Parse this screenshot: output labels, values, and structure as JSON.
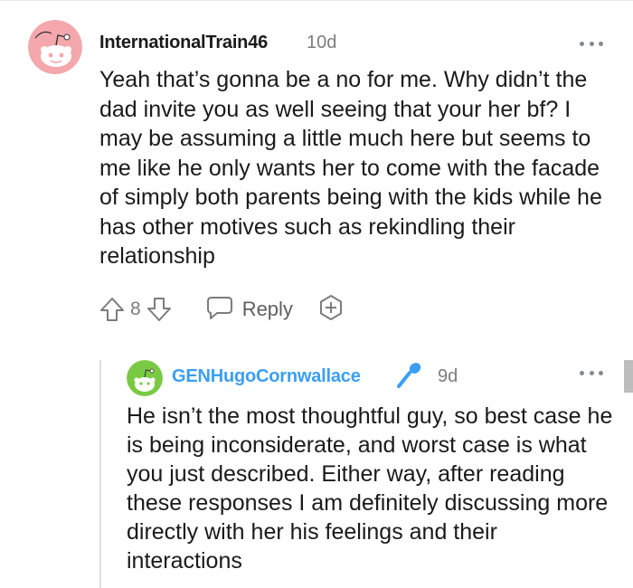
{
  "comment": {
    "username": "InternationalTrain46",
    "age": "10d",
    "avatar_color": "#f4a8ad",
    "body": "Yeah that’s gonna be a no for me. Why didn’t the dad invite you as well seeing that your her bf? I may be assuming a little much here but seems to me like he only wants her to come with the facade of simply both parents being with the kids while he has other motives such as rekindling their relationship",
    "score": "8",
    "reply_label": "Reply",
    "icons": [
      "snoo-avatar-icon",
      "more-options-icon",
      "upvote-icon",
      "downvote-icon",
      "reply-bubble-icon",
      "award-plus-icon"
    ]
  },
  "reply": {
    "username": "GENHugoCornwallace",
    "username_color": "#3b9ff3",
    "age": "9d",
    "avatar_color": "#7ac943",
    "body": "He isn’t the most thoughtful guy, so best case he is being inconsiderate, and worst case is what you just described. Either way, after reading these responses I am definitely discussing more directly with her his feelings and their interactions",
    "icons": [
      "snoo-avatar-icon",
      "microphone-icon",
      "more-options-icon"
    ]
  }
}
